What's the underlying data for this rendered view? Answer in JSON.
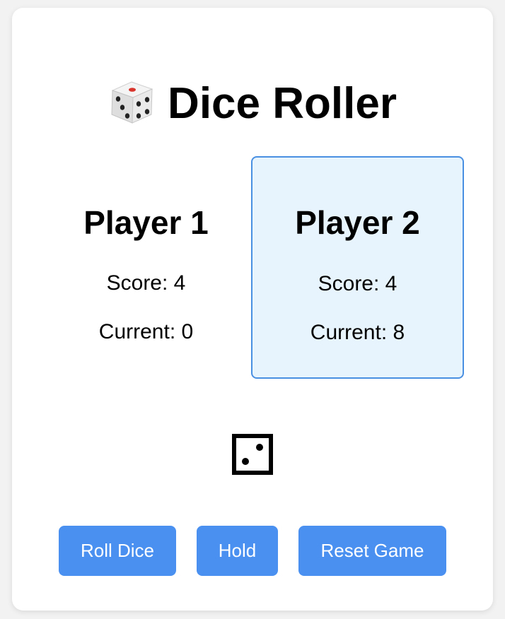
{
  "app": {
    "title": "Dice Roller",
    "title_icon": "dice-emoji-icon"
  },
  "players": [
    {
      "name": "Player 1",
      "score_text": "Score: 4",
      "current_text": "Current: 0",
      "active": false
    },
    {
      "name": "Player 2",
      "score_text": "Score: 4",
      "current_text": "Current: 8",
      "active": true
    }
  ],
  "dice": {
    "value": 2,
    "icon": "die-face-two-icon"
  },
  "buttons": {
    "roll_label": "Roll Dice",
    "hold_label": "Hold",
    "reset_label": "Reset Game"
  },
  "colors": {
    "button_bg": "#4a90f0",
    "active_player_bg": "#e8f4fd",
    "active_player_border": "#4a90e2"
  }
}
